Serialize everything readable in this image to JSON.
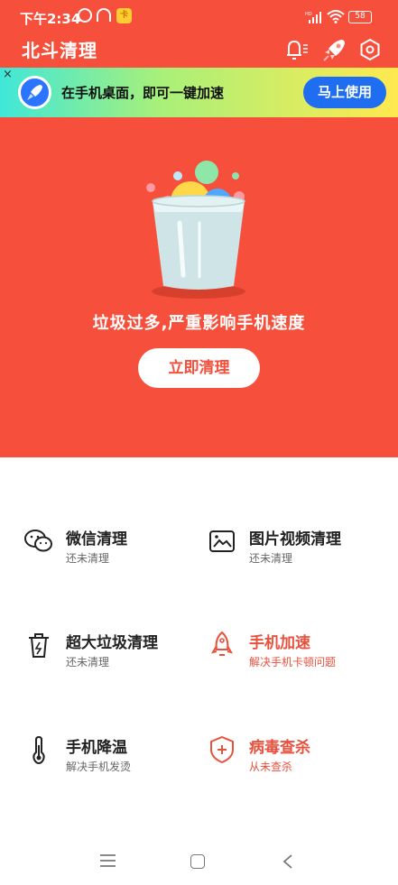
{
  "status_bar": {
    "time": "下午2:34",
    "battery": "58",
    "network": "HD"
  },
  "app_bar": {
    "title": "北斗清理"
  },
  "banner": {
    "text": "在手机桌面，即可一键加速",
    "button": "马上使用",
    "close": "×"
  },
  "hero": {
    "message": "垃圾过多,严重影响手机速度",
    "button": "立即清理"
  },
  "features": [
    {
      "title": "微信清理",
      "subtitle": "还未清理",
      "icon": "wechat-icon",
      "accent": false
    },
    {
      "title": "图片视频清理",
      "subtitle": "还未清理",
      "icon": "image-icon",
      "accent": false
    },
    {
      "title": "超大垃圾清理",
      "subtitle": "还未清理",
      "icon": "trash-icon",
      "accent": false
    },
    {
      "title": "手机加速",
      "subtitle": "解决手机卡顿问题",
      "icon": "rocket-icon",
      "accent": true
    },
    {
      "title": "手机降温",
      "subtitle": "解决手机发烫",
      "icon": "thermometer-icon",
      "accent": false
    },
    {
      "title": "病毒查杀",
      "subtitle": "从未查杀",
      "icon": "shield-icon",
      "accent": true
    }
  ],
  "colors": {
    "primary": "#f64f3b",
    "accent_text": "#e8513e",
    "banner_button": "#1f6df0"
  }
}
